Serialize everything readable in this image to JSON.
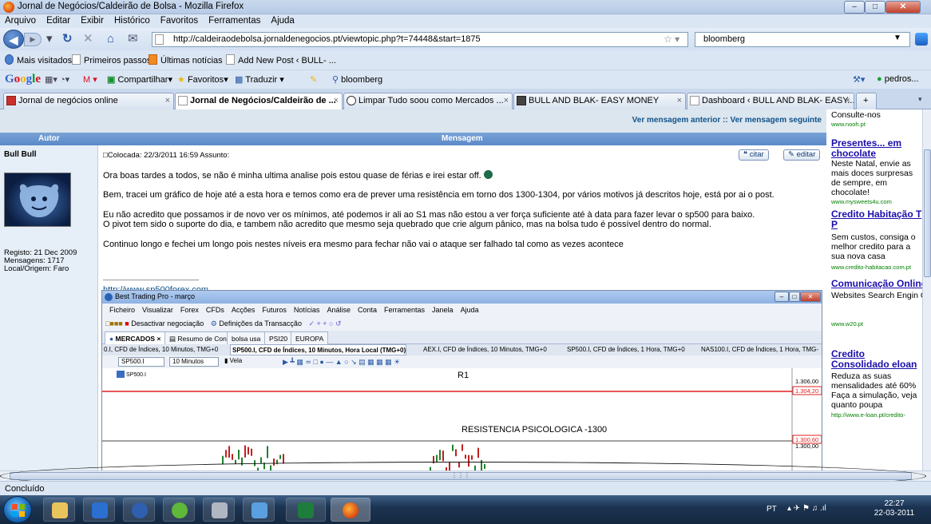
{
  "window": {
    "title": "Jornal de Negócios/Caldeirão de Bolsa - Mozilla Firefox",
    "min": "–",
    "max": "□",
    "close": "✕"
  },
  "menubar": [
    "Arquivo",
    "Editar",
    "Exibir",
    "Histórico",
    "Favoritos",
    "Ferramentas",
    "Ajuda"
  ],
  "nav": {
    "url": "http://caldeiraodebolsa.jornaldenegocios.pt/viewtopic.php?t=74448&start=1875",
    "search_value": "bloomberg"
  },
  "bookmarks": [
    "Mais visitados",
    "Primeiros passos",
    "Últimas notícias",
    "Add New Post ‹ BULL- ..."
  ],
  "google_toolbar": {
    "logo": [
      "G",
      "o",
      "o",
      "g",
      "l",
      "e"
    ],
    "items": [
      "Compartilhar",
      "Favoritos",
      "Traduzir",
      "bloomberg"
    ],
    "user": "pedros..."
  },
  "tabs": [
    {
      "label": "Jornal de negócios online",
      "active": false
    },
    {
      "label": "Jornal de Negócios/Caldeirão de ...",
      "active": true
    },
    {
      "label": "Limpar Tudo soou como Mercados ...",
      "active": false
    },
    {
      "label": "BULL AND BLAK- EASY MONEY",
      "active": false
    },
    {
      "label": "Dashboard ‹ BULL AND BLAK- EASY...",
      "active": false
    }
  ],
  "forum": {
    "topnav_link": "Ver mensagem anterior :: Ver mensagem seguinte",
    "header_author": "Autor",
    "header_message": "Mensagem",
    "author_name": "Bull Bull",
    "author_meta": [
      "Registo: 21 Dec 2009",
      "Mensagens: 1717",
      "Local/Origem: Faro"
    ],
    "post_meta": "Colocada: 22/3/2011 16:59    Assunto:",
    "btn_quote": "citar",
    "btn_edit": "editar",
    "lines": [
      "Ora boas tardes a todos, se não é minha ultima analise pois estou quase de férias e irei estar off.",
      "Bem, tracei um gráfico de hoje até a esta hora e temos como era de prever uma resistência em torno dos 1300-1304, por vários motivos já descritos hoje, está por ai o post.",
      "Eu não acredito que possamos ir de novo ver os mínimos, até podemos ir ali ao S1 mas não estou a ver força suficiente até à data para fazer levar o sp500 para baixo.",
      "O pivot tem sido o suporte do dia, e tambem não acredito que mesmo seja quebrado que crie algum pânico, mas na bolsa tudo é possível dentro do normal.",
      "Continuo longo e fechei um longo pois nestes níveis era mesmo para fechar não vai o ataque ser falhado tal como as vezes acontece"
    ],
    "signature_link": "http://www.sp500forex.com"
  },
  "embedded_app": {
    "title": "Best Trading Pro - março",
    "menu": [
      "Ficheiro",
      "Visualizar",
      "Forex",
      "CFDs",
      "Acções",
      "Futuros",
      "Notícias",
      "Análise",
      "Conta",
      "Ferramentas",
      "Janela",
      "Ajuda"
    ],
    "toolbar": [
      "Desactivar negociação",
      "Definições da Transacção"
    ],
    "tabs": [
      "MERCADOS",
      "Resumo de Conta",
      "bolsa usa",
      "PSI20",
      "EUROPA"
    ],
    "chart_tabs": [
      {
        "label": "0.I, CFD de Índices, 10 Minutos, TMG+0",
        "active": false
      },
      {
        "label": "SP500.I, CFD de Índices, 10 Minutos, Hora Local (TMG+0)",
        "active": true
      },
      {
        "label": "AEX.I, CFD de Índices, 10 Minutos, TMG+0",
        "active": false
      },
      {
        "label": "SP500.I, CFD de Índices, 1 Hora, TMG+0",
        "active": false
      },
      {
        "label": "NAS100.I, CFD de Índices, 1 Hora, TMG-",
        "active": false
      }
    ],
    "symbol": "SP500.I",
    "interval": "10 Minutos",
    "chart_style": "Vela",
    "instrument_label": "SP500.I",
    "label_r1": "R1",
    "label_resist": "RESISTENCIA PSICOLOGICA -1300",
    "price_ticks": [
      "1.306,00",
      "1.304,20",
      "1.300,60",
      "1.300,00"
    ]
  },
  "ads": [
    {
      "title": "",
      "text": "Consulte-nos",
      "url": "www.nooh.pt"
    },
    {
      "title": "Presentes... em chocolate",
      "text": "Neste Natal, envie as mais doces surpresas de sempre, em chocolate!",
      "url": "www.mysweets4u.com"
    },
    {
      "title": "Credito Habitação T P",
      "text": "Sem custos, consiga o melhor credito para a sua nova casa",
      "url": "www.credito-habitacao.com.pt"
    },
    {
      "title": "Comunicação Online",
      "text": "Websites Search Engin Optimization Interactive Marketing, Web 2.0",
      "url": "www.w20.pt"
    },
    {
      "title": "Credito Consolidado eloan",
      "text": "Reduza as suas mensalidades até 60% Faça a simulação, veja quanto poupa",
      "url": "http://www.e-loan.pt/credito-"
    }
  ],
  "status": "Concluído",
  "taskbar": {
    "lang": "PT",
    "time": "22:27",
    "date": "22-03-2011"
  },
  "colors": {
    "accent": "#5a89c9",
    "link": "#105289",
    "r1_line": "#e02020"
  }
}
